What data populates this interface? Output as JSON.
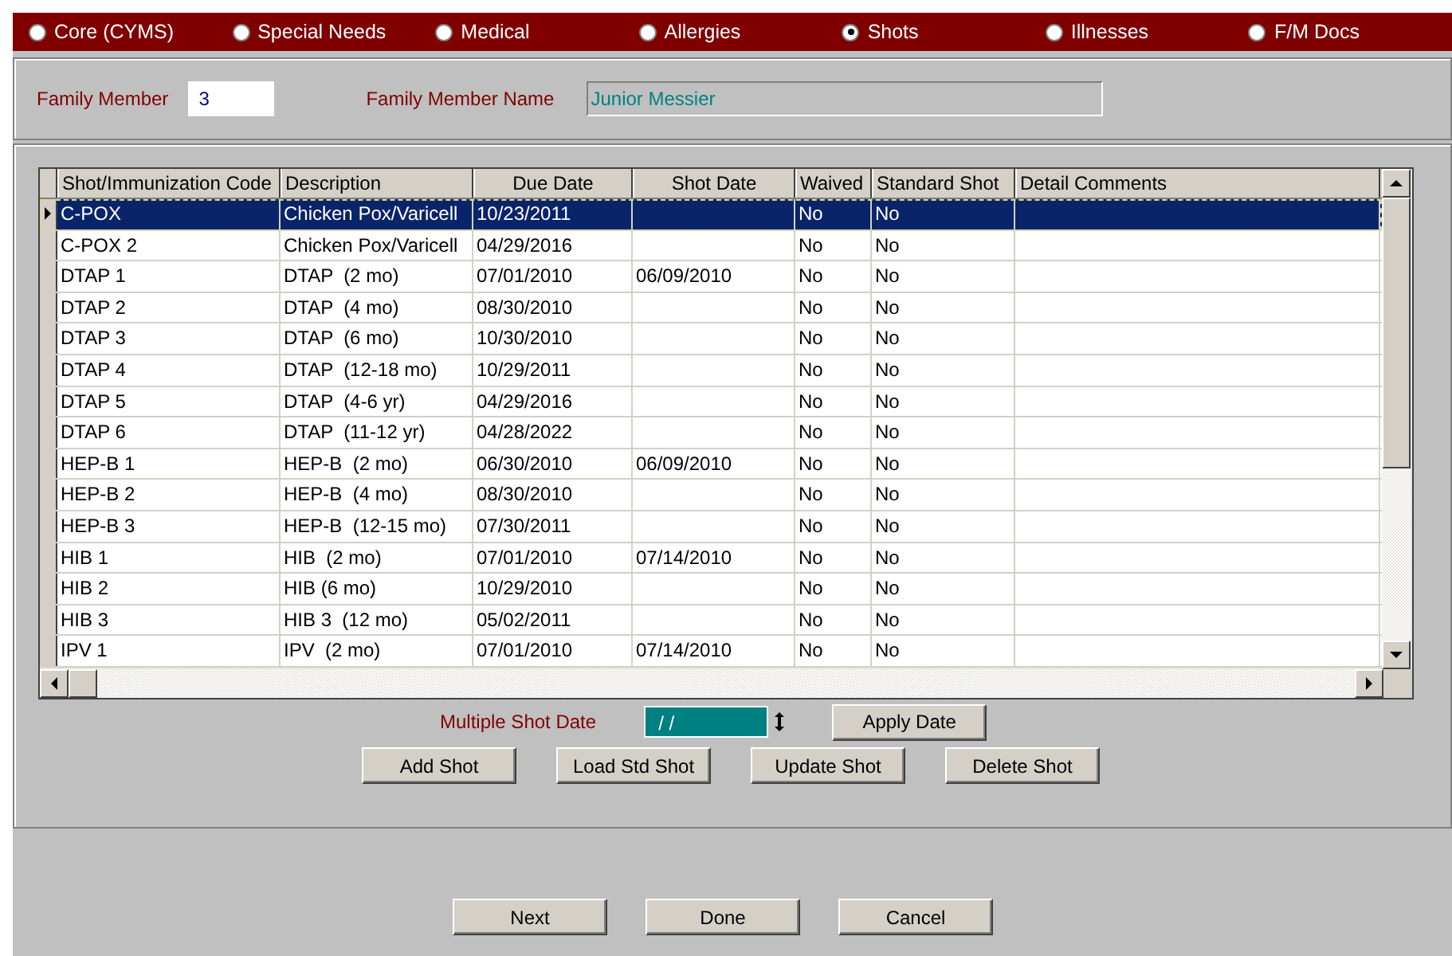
{
  "tabs": [
    {
      "label": "Core (CYMS)",
      "selected": false
    },
    {
      "label": "Special Needs",
      "selected": false
    },
    {
      "label": "Medical",
      "selected": false
    },
    {
      "label": "Allergies",
      "selected": false
    },
    {
      "label": "Shots",
      "selected": true
    },
    {
      "label": "Illnesses",
      "selected": false
    },
    {
      "label": "F/M Docs",
      "selected": false
    }
  ],
  "family_member": {
    "label": "Family Member",
    "value": "3"
  },
  "family_member_name": {
    "label": "Family Member Name",
    "value": "Junior Messier"
  },
  "table": {
    "columns": [
      "Shot/Immunization Code",
      "Description",
      "Due Date",
      "Shot Date",
      "Waived",
      "Standard Shot",
      "Detail Comments"
    ],
    "rows": [
      {
        "selected": true,
        "cells": [
          "C-POX",
          "Chicken Pox/Varicell",
          "10/23/2011",
          "",
          "No",
          "No",
          ""
        ]
      },
      {
        "selected": false,
        "cells": [
          "C-POX 2",
          "Chicken Pox/Varicell",
          "04/29/2016",
          "",
          "No",
          "No",
          ""
        ]
      },
      {
        "selected": false,
        "cells": [
          "DTAP 1",
          "DTAP  (2 mo)",
          "07/01/2010",
          "06/09/2010",
          "No",
          "No",
          ""
        ]
      },
      {
        "selected": false,
        "cells": [
          "DTAP 2",
          "DTAP  (4 mo)",
          "08/30/2010",
          "",
          "No",
          "No",
          ""
        ]
      },
      {
        "selected": false,
        "cells": [
          "DTAP 3",
          "DTAP  (6 mo)",
          "10/30/2010",
          "",
          "No",
          "No",
          ""
        ]
      },
      {
        "selected": false,
        "cells": [
          "DTAP 4",
          "DTAP  (12-18 mo)",
          "10/29/2011",
          "",
          "No",
          "No",
          ""
        ]
      },
      {
        "selected": false,
        "cells": [
          "DTAP 5",
          "DTAP  (4-6 yr)",
          "04/29/2016",
          "",
          "No",
          "No",
          ""
        ]
      },
      {
        "selected": false,
        "cells": [
          "DTAP 6",
          "DTAP  (11-12 yr)",
          "04/28/2022",
          "",
          "No",
          "No",
          ""
        ]
      },
      {
        "selected": false,
        "cells": [
          "HEP-B 1",
          "HEP-B  (2 mo)",
          "06/30/2010",
          "06/09/2010",
          "No",
          "No",
          ""
        ]
      },
      {
        "selected": false,
        "cells": [
          "HEP-B 2",
          "HEP-B  (4 mo)",
          "08/30/2010",
          "",
          "No",
          "No",
          ""
        ]
      },
      {
        "selected": false,
        "cells": [
          "HEP-B 3",
          "HEP-B  (12-15 mo)",
          "07/30/2011",
          "",
          "No",
          "No",
          ""
        ]
      },
      {
        "selected": false,
        "cells": [
          "HIB 1",
          "HIB  (2 mo)",
          "07/01/2010",
          "07/14/2010",
          "No",
          "No",
          ""
        ]
      },
      {
        "selected": false,
        "cells": [
          "HIB 2",
          "HIB (6 mo)",
          "10/29/2010",
          "",
          "No",
          "No",
          ""
        ]
      },
      {
        "selected": false,
        "cells": [
          "HIB 3",
          "HIB 3  (12 mo)",
          "05/02/2011",
          "",
          "No",
          "No",
          ""
        ]
      },
      {
        "selected": false,
        "cells": [
          "IPV 1",
          "IPV  (2 mo)",
          "07/01/2010",
          "07/14/2010",
          "No",
          "No",
          ""
        ]
      }
    ]
  },
  "multiple_shot_date": {
    "label": "Multiple Shot Date",
    "value": "/ /"
  },
  "apply_button": "Apply Date",
  "shot_buttons": [
    "Add Shot",
    "Load Std Shot",
    "Update Shot",
    "Delete Shot"
  ],
  "nav_buttons": [
    "Next",
    "Done",
    "Cancel"
  ]
}
